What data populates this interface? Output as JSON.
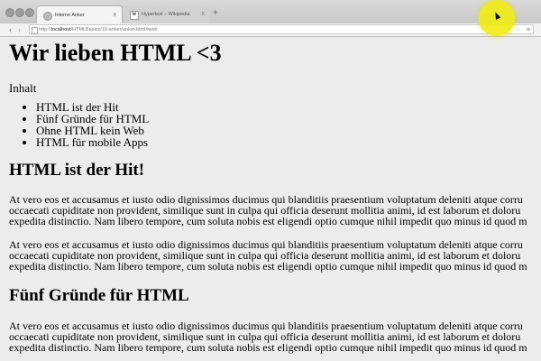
{
  "browser": {
    "tabs": [
      {
        "title": "Interne Anker",
        "favicon": "page-icon",
        "close": "x"
      },
      {
        "title": "Hypertext – Wikipedia",
        "favicon": "W",
        "close": "x"
      }
    ],
    "new_tab": "+",
    "url": {
      "scheme": "http://",
      "host": "localhost",
      "path": "/HTMLBasics/10-anker/anker.html#web"
    },
    "nav": {
      "back": "‹",
      "forward": "›"
    }
  },
  "page": {
    "title": "Wir lieben HTML <3",
    "toc_title": "Inhalt",
    "toc_items": [
      "HTML ist der Hit",
      "Fünf Gründe für HTML",
      "Ohne HTML kein Web",
      "HTML für mobile Apps"
    ],
    "sections": [
      {
        "heading": "HTML ist der Hit!",
        "paragraphs": [
          [
            "At vero eos et accusamus et iusto odio dignissimos ducimus qui blanditiis praesentium voluptatum deleniti atque corru",
            "occaecati cupiditate non provident, similique sunt in culpa qui officia deserunt mollitia animi, id est laborum et doloru",
            "expedita distinctio. Nam libero tempore, cum soluta nobis est eligendi optio cumque nihil impedit quo minus id quod m"
          ],
          [
            "At vero eos et accusamus et iusto odio dignissimos ducimus qui blanditiis praesentium voluptatum deleniti atque corru",
            "occaecati cupiditate non provident, similique sunt in culpa qui officia deserunt mollitia animi, id est laborum et doloru",
            "expedita distinctio. Nam libero tempore, cum soluta nobis est eligendi optio cumque nihil impedit quo minus id quod m"
          ]
        ]
      },
      {
        "heading": "Fünf Gründe für HTML",
        "paragraphs": [
          [
            "At vero eos et accusamus et iusto odio dignissimos ducimus qui blanditiis praesentium voluptatum deleniti atque corru",
            "occaecati cupiditate non provident, similique sunt in culpa qui officia deserunt mollitia animi, id est laborum et doloru",
            "expedita distinctio. Nam libero tempore, cum soluta nobis est eligendi optio cumque nihil impedit quo minus id quod m"
          ]
        ]
      }
    ]
  }
}
